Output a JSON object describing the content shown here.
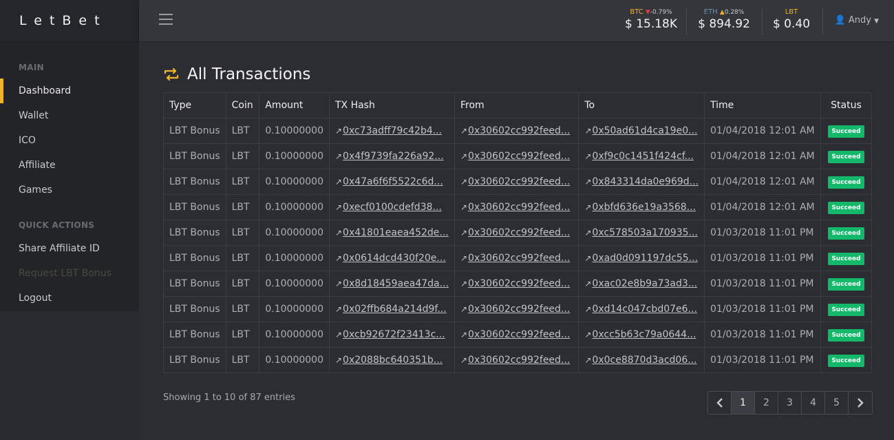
{
  "brand": "LetBet",
  "sidebar": {
    "sections": [
      {
        "title": "MAIN",
        "items": [
          {
            "label": "Dashboard",
            "active": true
          },
          {
            "label": "Wallet"
          },
          {
            "label": "ICO"
          },
          {
            "label": "Affiliate"
          },
          {
            "label": "Games"
          }
        ]
      },
      {
        "title": "QUICK ACTIONS",
        "items": [
          {
            "label": "Share Affiliate ID"
          },
          {
            "label": "Request LBT Bonus",
            "disabled": true
          },
          {
            "label": "Logout"
          }
        ]
      }
    ]
  },
  "topbar": {
    "tickers": [
      {
        "symbol": "BTC",
        "change": "-0.79%",
        "direction": "down",
        "price": "$ 15.18K",
        "symbol_color": "#f0b429"
      },
      {
        "symbol": "ETH",
        "change": "0.28%",
        "direction": "up",
        "price": "$ 894.92",
        "symbol_color": "#6f8fb3"
      },
      {
        "symbol": "LBT",
        "change": "",
        "direction": "",
        "price": "$ 0.40",
        "symbol_color": "#f0b429"
      }
    ],
    "user": "Andy"
  },
  "page": {
    "title": "All Transactions"
  },
  "table": {
    "columns": [
      "Type",
      "Coin",
      "Amount",
      "TX Hash",
      "From",
      "To",
      "Time",
      "Status"
    ],
    "rows": [
      {
        "type": "LBT Bonus",
        "coin": "LBT",
        "amount": "0.10000000",
        "tx": "0xc73adff79c42b4...",
        "from": "0x30602cc992feed...",
        "to": "0x50ad61d4ca19e0...",
        "time": "01/04/2018 12:01 AM",
        "status": "Succeed"
      },
      {
        "type": "LBT Bonus",
        "coin": "LBT",
        "amount": "0.10000000",
        "tx": "0x4f9739fa226a92...",
        "from": "0x30602cc992feed...",
        "to": "0xf9c0c1451f424cf...",
        "time": "01/04/2018 12:01 AM",
        "status": "Succeed"
      },
      {
        "type": "LBT Bonus",
        "coin": "LBT",
        "amount": "0.10000000",
        "tx": "0x47a6f6f5522c6d...",
        "from": "0x30602cc992feed...",
        "to": "0x843314da0e969d...",
        "time": "01/04/2018 12:01 AM",
        "status": "Succeed"
      },
      {
        "type": "LBT Bonus",
        "coin": "LBT",
        "amount": "0.10000000",
        "tx": "0xecf0100cdefd38...",
        "from": "0x30602cc992feed...",
        "to": "0xbfd636e19a3568...",
        "time": "01/04/2018 12:01 AM",
        "status": "Succeed"
      },
      {
        "type": "LBT Bonus",
        "coin": "LBT",
        "amount": "0.10000000",
        "tx": "0x41801eaea452de...",
        "from": "0x30602cc992feed...",
        "to": "0xc578503a170935...",
        "time": "01/03/2018 11:01 PM",
        "status": "Succeed"
      },
      {
        "type": "LBT Bonus",
        "coin": "LBT",
        "amount": "0.10000000",
        "tx": "0x0614dcd430f20e...",
        "from": "0x30602cc992feed...",
        "to": "0xad0d091197dc55...",
        "time": "01/03/2018 11:01 PM",
        "status": "Succeed"
      },
      {
        "type": "LBT Bonus",
        "coin": "LBT",
        "amount": "0.10000000",
        "tx": "0x8d18459aea47da...",
        "from": "0x30602cc992feed...",
        "to": "0xac02e8b9a73ad3...",
        "time": "01/03/2018 11:01 PM",
        "status": "Succeed"
      },
      {
        "type": "LBT Bonus",
        "coin": "LBT",
        "amount": "0.10000000",
        "tx": "0x02ffb684a214d9f...",
        "from": "0x30602cc992feed...",
        "to": "0xd14c047cbd07e6...",
        "time": "01/03/2018 11:01 PM",
        "status": "Succeed"
      },
      {
        "type": "LBT Bonus",
        "coin": "LBT",
        "amount": "0.10000000",
        "tx": "0xcb92672f23413c...",
        "from": "0x30602cc992feed...",
        "to": "0xcc5b63c79a0644...",
        "time": "01/03/2018 11:01 PM",
        "status": "Succeed"
      },
      {
        "type": "LBT Bonus",
        "coin": "LBT",
        "amount": "0.10000000",
        "tx": "0x2088bc640351b...",
        "from": "0x30602cc992feed...",
        "to": "0x0ce8870d3acd06...",
        "time": "01/03/2018 11:01 PM",
        "status": "Succeed"
      }
    ]
  },
  "footer": {
    "showing": "Showing 1 to 10 of 87 entries",
    "pages": [
      "1",
      "2",
      "3",
      "4",
      "5"
    ],
    "current_page": "1"
  },
  "colors": {
    "accent": "#f0b429",
    "success": "#14b86a",
    "down": "#e03c3c",
    "up": "#f0b429"
  },
  "icons": {
    "menu": "hamburger-icon",
    "title": "transfer-arrows-icon",
    "external_link": "external-link-icon",
    "user": "user-icon",
    "caret": "caret-down-icon",
    "prev": "chevron-left-icon",
    "next": "chevron-right-icon"
  }
}
